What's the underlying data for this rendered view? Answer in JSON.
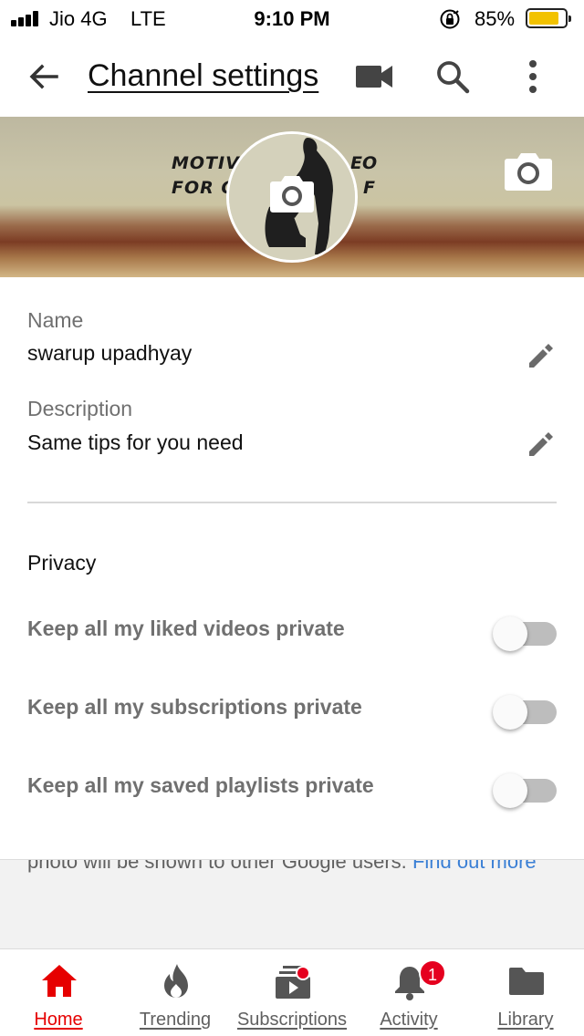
{
  "status_bar": {
    "carrier": "Jio 4G",
    "network": "LTE",
    "time": "9:10 PM",
    "battery_percent": "85%",
    "battery_level": 0.85
  },
  "app_bar": {
    "title": "Channel settings",
    "icons": [
      "arrow-back-icon",
      "video-camera-icon",
      "search-icon",
      "more-vert-icon"
    ]
  },
  "banner": {
    "text_line1": "MOTIVA",
    "text_line2": "FOR GR",
    "text_right_line1": "EO",
    "text_right_line2": "F"
  },
  "profile": {
    "name_label": "Name",
    "name_value": "swarup upadhyay",
    "description_label": "Description",
    "description_value": "Same tips for you need"
  },
  "privacy": {
    "heading": "Privacy",
    "items": [
      {
        "label": "Keep all my liked videos private",
        "enabled": false
      },
      {
        "label": "Keep all my subscriptions private",
        "enabled": false
      },
      {
        "label": "Keep all my saved playlists private",
        "enabled": false
      }
    ]
  },
  "info": {
    "text": "photo will be shown to other Google users.",
    "link_text": "Find out more"
  },
  "bottom_nav": {
    "items": [
      {
        "label": "Home",
        "icon": "home-icon",
        "active": true
      },
      {
        "label": "Trending",
        "icon": "flame-icon",
        "active": false
      },
      {
        "label": "Subscriptions",
        "icon": "subscriptions-icon",
        "active": false
      },
      {
        "label": "Activity",
        "icon": "bell-icon",
        "active": false,
        "badge": "1"
      },
      {
        "label": "Library",
        "icon": "folder-icon",
        "active": false
      }
    ]
  },
  "colors": {
    "accent_red": "#e60000",
    "link_blue": "#3a7fd5",
    "battery_yellow": "#f2c200"
  }
}
